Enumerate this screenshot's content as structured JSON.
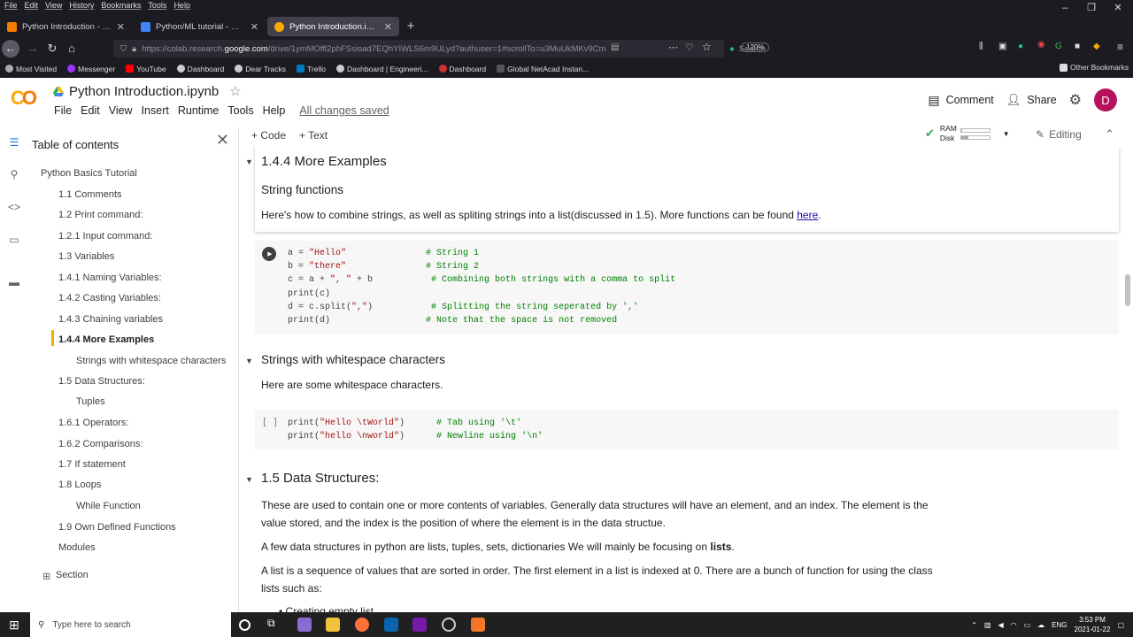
{
  "browser": {
    "menu": [
      "File",
      "Edit",
      "View",
      "History",
      "Bookmarks",
      "Tools",
      "Help"
    ],
    "tabs": [
      {
        "title": "Python Introduction - Jupyter",
        "color": "#f57c00"
      },
      {
        "title": "Python/ML tutorial - Google D",
        "color": "#4285f4"
      },
      {
        "title": "Python Introduction.ipynb - Co",
        "color": "#f9ab00"
      }
    ],
    "url_prefix": "https://colab.research.",
    "url_domain": "google.com",
    "url_rest": "/drive/1ymMOffl2phFSsioad7EQhYIWLS6m9ULyd?authuser=1#scrollTo=u3MuUkMKv9Cm",
    "zoom": "120%",
    "search_placeholder": "Search",
    "bookmarks": [
      "Most Visited",
      "Messenger",
      "YouTube",
      "Dashboard",
      "Dear Tracks",
      "Trello",
      "Dashboard | Engineeri...",
      "Dashboard",
      "Global NetAcad Instan..."
    ],
    "other_bookmarks": "Other Bookmarks"
  },
  "colab": {
    "logo": "CO",
    "title": "Python Introduction.ipynb",
    "menu": [
      "File",
      "Edit",
      "View",
      "Insert",
      "Runtime",
      "Tools",
      "Help"
    ],
    "saved_status": "All changes saved",
    "comment": "Comment",
    "share": "Share",
    "avatar": "D",
    "accent": "#f9ab00"
  },
  "toolbar": {
    "add_code": "+ Code",
    "add_text": "+ Text",
    "ram": "RAM",
    "disk": "Disk",
    "ram_used": 0.05,
    "disk_used": 0.25,
    "editing": "Editing"
  },
  "sidebar": {
    "title": "Table of contents",
    "items": [
      "Python Basics Tutorial",
      "1.1 Comments",
      "1.2 Print command:",
      "1.2.1 Input command:",
      "1.3 Variables",
      "1.4.1 Naming Variables:",
      "1.4.2 Casting Variables:",
      "1.4.3 Chaining variables",
      "1.4.4 More Examples",
      "Strings with whitespace characters",
      "1.5 Data Structures:",
      "Tuples",
      "1.6.1 Operators:",
      "1.6.2 Comparisons:",
      "1.7 If statement",
      "1.8 Loops",
      "While Function",
      "1.9 Own Defined Functions",
      "Modules",
      "Section"
    ]
  },
  "content": {
    "h_more_examples": "1.4.4 More Examples",
    "h_string_functions": "String functions",
    "p_string_functions": "Here's how to combine strings, as well as spliting strings into a list(discussed in 1.5). More functions can be found ",
    "link_here": "here",
    "period": ".",
    "code1": [
      {
        "code": "a = ",
        "str": "\"Hello\"",
        "pad": "               ",
        "cmt": "# String 1"
      },
      {
        "code": "b = ",
        "str": "\"there\"",
        "pad": "               ",
        "cmt": "# String 2"
      },
      {
        "code": "c = a + ",
        "str": "\", \"",
        "pad": " + b           ",
        "cmt": "# Combining both strings with a comma to split"
      },
      {
        "code": "print(c)",
        "str": "",
        "pad": "",
        "cmt": ""
      },
      {
        "code": "d = c.split(",
        "str": "\",\"",
        "pad": ")           ",
        "cmt": "# Splitting the string seperated by ','"
      },
      {
        "code": "print(d)",
        "str": "",
        "pad": "                  ",
        "cmt": "# Note that the space is not removed"
      }
    ],
    "h_whitespace": "Strings with whitespace characters",
    "p_whitespace": "Here are some whitespace characters.",
    "exec_count": "[ ]",
    "code2": [
      {
        "code": "print(",
        "str": "\"Hello \\tWorld\"",
        "pad": ")      ",
        "cmt": "# Tab using '\\t'"
      },
      {
        "code": "print(",
        "str": "\"hello \\nworld\"",
        "pad": ")      ",
        "cmt": "# Newline using '\\n'"
      }
    ],
    "h_data_structures": "1.5 Data Structures:",
    "p_ds1_line1": "These are used to contain one or more contents of variables. Generally data structures will have an element, and an index. The element is the",
    "p_ds1_line2": "value stored, and the index is the position of where the element is in the data structue.",
    "p_ds2_a": "A few data structures in python are lists, tuples, sets, dictionaries We will mainly be focusing on ",
    "p_ds2_b": "lists",
    "p_ds2_c": ".",
    "p_ds3_line1": "A list is a sequence of values that are sorted in order. The first element in a list is indexed at 0. There are a bunch of function for using the class",
    "p_ds3_line2": "lists such as:",
    "bullet1": "Creating empty list"
  },
  "taskbar": {
    "search": "Type here to search",
    "lang": "ENG",
    "time": "3:53 PM",
    "date": "2021-01-22"
  }
}
